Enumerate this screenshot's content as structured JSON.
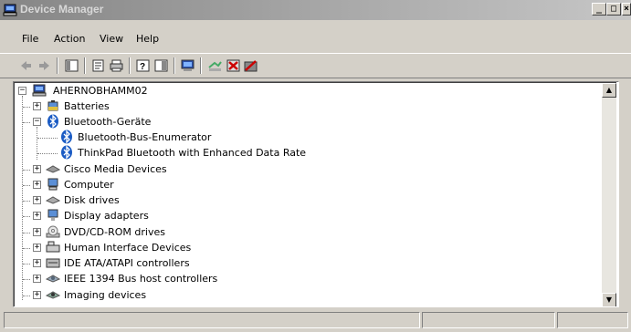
{
  "window": {
    "title": "Device Manager",
    "buttons": {
      "minimize": "_",
      "maximize": "□",
      "close": "×"
    }
  },
  "menu": [
    "File",
    "Action",
    "View",
    "Help"
  ],
  "toolbar": {
    "icons": [
      "back-icon",
      "forward-icon",
      "show-hide-tree-icon",
      "properties-icon",
      "print-icon",
      "help-icon",
      "show-hide-action-pane-icon",
      "computer-icon",
      "scan-hardware-icon",
      "uninstall-icon",
      "disable-icon"
    ]
  },
  "tree": {
    "root": "AHERNOBHAMM02",
    "items": [
      {
        "label": "Batteries",
        "expander": "+",
        "icon": "battery-icon"
      },
      {
        "label": "Bluetooth-Geräte",
        "expander": "−",
        "icon": "bluetooth-icon",
        "children": [
          {
            "label": "Bluetooth-Bus-Enumerator",
            "icon": "bluetooth-icon"
          },
          {
            "label": "ThinkPad Bluetooth with Enhanced Data Rate",
            "icon": "bluetooth-icon"
          }
        ]
      },
      {
        "label": "Cisco Media Devices",
        "expander": "+",
        "icon": "media-device-icon"
      },
      {
        "label": "Computer",
        "expander": "+",
        "icon": "computer-icon"
      },
      {
        "label": "Disk drives",
        "expander": "+",
        "icon": "disk-drive-icon"
      },
      {
        "label": "Display adapters",
        "expander": "+",
        "icon": "display-adapter-icon"
      },
      {
        "label": "DVD/CD-ROM drives",
        "expander": "+",
        "icon": "cdrom-icon"
      },
      {
        "label": "Human Interface Devices",
        "expander": "+",
        "icon": "hid-icon"
      },
      {
        "label": "IDE ATA/ATAPI controllers",
        "expander": "+",
        "icon": "ide-controller-icon"
      },
      {
        "label": "IEEE 1394 Bus host controllers",
        "expander": "+",
        "icon": "ieee1394-icon"
      },
      {
        "label": "Imaging devices",
        "expander": "+",
        "icon": "imaging-device-icon"
      }
    ]
  },
  "colors": {
    "titlebar_start": "#868686",
    "titlebar_end": "#c6c6c6",
    "chrome": "#d4d0c8",
    "bluetooth": "#1a5bc4"
  }
}
